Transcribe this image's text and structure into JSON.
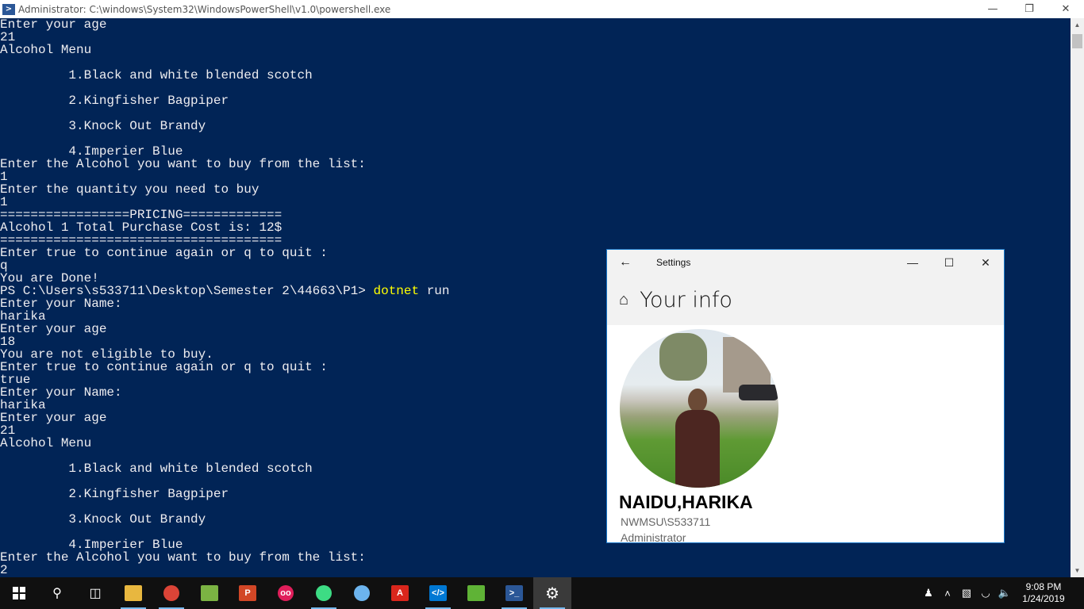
{
  "powershell": {
    "title": "Administrator: C:\\windows\\System32\\WindowsPowerShell\\v1.0\\powershell.exe",
    "lines": [
      "Enter your age",
      "21",
      "Alcohol Menu",
      "",
      "         1.Black and white blended scotch",
      "",
      "         2.Kingfisher Bagpiper",
      "",
      "         3.Knock Out Brandy",
      "",
      "         4.Imperier Blue",
      "Enter the Alcohol you want to buy from the list:",
      "1",
      "Enter the quantity you need to buy",
      "1",
      "=================PRICING=============",
      "Alcohol 1 Total Purchase Cost is: 12$",
      "=====================================",
      "Enter true to continue again or q to quit :",
      "q",
      "You are Done!",
      "PS C:\\Users\\s533711\\Desktop\\Semester 2\\44663\\P1> ",
      "Enter your Name:",
      "harika",
      "Enter your age",
      "18",
      "You are not eligible to buy.",
      "Enter true to continue again or q to quit :",
      "true",
      "Enter your Name:",
      "harika",
      "Enter your age",
      "21",
      "Alcohol Menu",
      "",
      "         1.Black and white blended scotch",
      "",
      "         2.Kingfisher Bagpiper",
      "",
      "         3.Knock Out Brandy",
      "",
      "         4.Imperier Blue",
      "Enter the Alcohol you want to buy from the list:",
      "2"
    ],
    "prompt_command": "dotnet",
    "prompt_args": " run"
  },
  "settings": {
    "title": "Settings",
    "header": "Your info",
    "user_name": "NAIDU,HARIKA",
    "account": "NWMSU\\S533711",
    "role": "Administrator"
  },
  "taskbar": {
    "time": "9:08 PM",
    "date": "1/24/2019"
  },
  "colors": {
    "console_bg": "#012456",
    "console_fg": "#eeedf0",
    "command": "#ffff00",
    "accent": "#1979ca"
  }
}
